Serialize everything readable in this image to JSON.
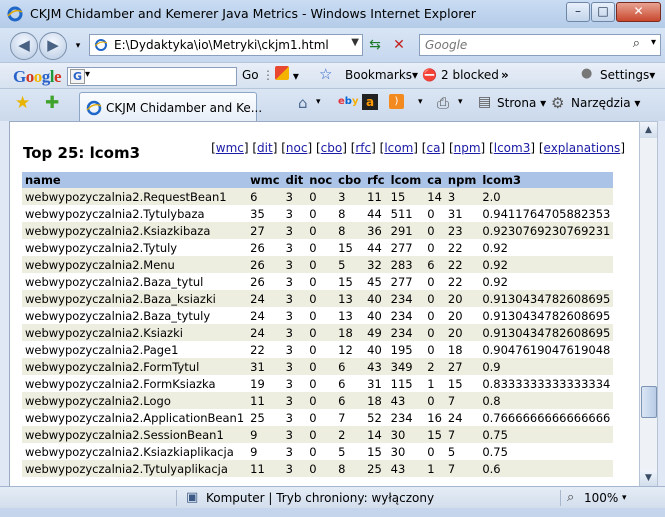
{
  "window": {
    "title": "CKJM Chidamber and Kemerer Java Metrics - Windows Internet Explorer",
    "minimize": "–",
    "maximize": "□",
    "close": "✕"
  },
  "address_bar": {
    "url": "E:\\Dydaktyka\\io\\Metryki\\ckjm1.html",
    "search_placeholder": "Google"
  },
  "google_toolbar": {
    "logo": "Google",
    "go": "Go",
    "bookmarks": "Bookmarks▾",
    "blocked": "2 blocked",
    "more": "»",
    "settings": "Settings▾"
  },
  "tab": {
    "label": "CKJM Chidamber and Ke..."
  },
  "commands": {
    "page": "Strona",
    "tools": "Narzędzia"
  },
  "page": {
    "heading": "Top 25: lcom3",
    "links": [
      "wmc",
      "dit",
      "noc",
      "cbo",
      "rfc",
      "lcom",
      "ca",
      "npm",
      "lcom3",
      "explanations"
    ],
    "columns": [
      "name",
      "wmc",
      "dit",
      "noc",
      "cbo",
      "rfc",
      "lcom",
      "ca",
      "npm",
      "lcom3"
    ],
    "rows": [
      [
        "webwypozyczalnia2.RequestBean1",
        "6",
        "3",
        "0",
        "3",
        "11",
        "15",
        "14",
        "3",
        "2.0"
      ],
      [
        "webwypozyczalnia2.Tytulybaza",
        "35",
        "3",
        "0",
        "8",
        "44",
        "511",
        "0",
        "31",
        "0.9411764705882353"
      ],
      [
        "webwypozyczalnia2.Ksiazkibaza",
        "27",
        "3",
        "0",
        "8",
        "36",
        "291",
        "0",
        "23",
        "0.9230769230769231"
      ],
      [
        "webwypozyczalnia2.Tytuly",
        "26",
        "3",
        "0",
        "15",
        "44",
        "277",
        "0",
        "22",
        "0.92"
      ],
      [
        "webwypozyczalnia2.Menu",
        "26",
        "3",
        "0",
        "5",
        "32",
        "283",
        "6",
        "22",
        "0.92"
      ],
      [
        "webwypozyczalnia2.Baza_tytul",
        "26",
        "3",
        "0",
        "15",
        "45",
        "277",
        "0",
        "22",
        "0.92"
      ],
      [
        "webwypozyczalnia2.Baza_ksiazki",
        "24",
        "3",
        "0",
        "13",
        "40",
        "234",
        "0",
        "20",
        "0.9130434782608695"
      ],
      [
        "webwypozyczalnia2.Baza_tytuly",
        "24",
        "3",
        "0",
        "13",
        "40",
        "234",
        "0",
        "20",
        "0.9130434782608695"
      ],
      [
        "webwypozyczalnia2.Ksiazki",
        "24",
        "3",
        "0",
        "18",
        "49",
        "234",
        "0",
        "20",
        "0.9130434782608695"
      ],
      [
        "webwypozyczalnia2.Page1",
        "22",
        "3",
        "0",
        "12",
        "40",
        "195",
        "0",
        "18",
        "0.9047619047619048"
      ],
      [
        "webwypozyczalnia2.FormTytul",
        "31",
        "3",
        "0",
        "6",
        "43",
        "349",
        "2",
        "27",
        "0.9"
      ],
      [
        "webwypozyczalnia2.FormKsiazka",
        "19",
        "3",
        "0",
        "6",
        "31",
        "115",
        "1",
        "15",
        "0.8333333333333334"
      ],
      [
        "webwypozyczalnia2.Logo",
        "11",
        "3",
        "0",
        "6",
        "18",
        "43",
        "0",
        "7",
        "0.8"
      ],
      [
        "webwypozyczalnia2.ApplicationBean1",
        "25",
        "3",
        "0",
        "7",
        "52",
        "234",
        "16",
        "24",
        "0.7666666666666666"
      ],
      [
        "webwypozyczalnia2.SessionBean1",
        "9",
        "3",
        "0",
        "2",
        "14",
        "30",
        "15",
        "7",
        "0.75"
      ],
      [
        "webwypozyczalnia2.Ksiazkiaplikacja",
        "9",
        "3",
        "0",
        "5",
        "15",
        "30",
        "0",
        "5",
        "0.75"
      ],
      [
        "webwypozyczalnia2.Tytulyaplikacja",
        "11",
        "3",
        "0",
        "8",
        "25",
        "43",
        "1",
        "7",
        "0.6"
      ]
    ]
  },
  "status": {
    "zone": "Komputer | Tryb chroniony: wyłączony",
    "zoom": "100%"
  }
}
